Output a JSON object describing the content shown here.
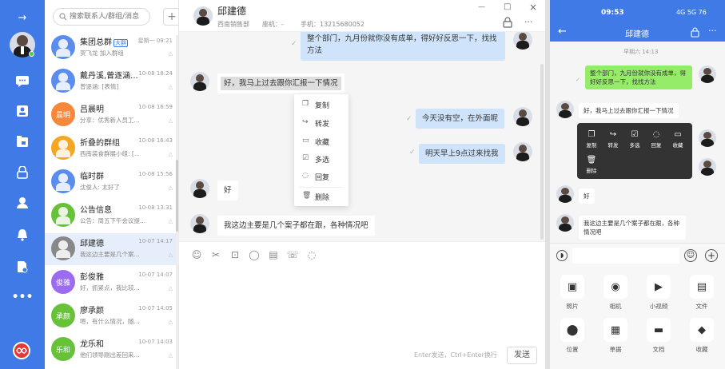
{
  "sidebar": {
    "expand_icon": "arrow-right",
    "icons": [
      "chat-bubble",
      "contacts-card",
      "calendar-folder",
      "lock",
      "user",
      "bell",
      "document-settings",
      "more-dots"
    ]
  },
  "conv_list": {
    "search_placeholder": "搜索联系人/群组/消息",
    "add_label": "+",
    "items": [
      {
        "name": "集团总群",
        "tag": "大群",
        "time": "星期一 09:21",
        "preview": "贺飞龙 加入群组",
        "avatar_text": "",
        "color": "#5b8def",
        "selected": false
      },
      {
        "name": "戴丹溪,曾逐涵...",
        "tag": "",
        "time": "10-08 18:24",
        "preview": "曾逐涵: [表情]",
        "avatar_text": "",
        "color": "#5b8def",
        "selected": false
      },
      {
        "name": "吕晨明",
        "tag": "",
        "time": "10-08 16:59",
        "preview": "分享：优秀新人员工...",
        "avatar_text": "晨明",
        "color": "#f5883b",
        "selected": false
      },
      {
        "name": "折叠的群组",
        "tag": "",
        "time": "10-08 16:43",
        "preview": "西南装食群展小组: [...",
        "avatar_text": "",
        "color": "#f5a623",
        "selected": false
      },
      {
        "name": "临时群",
        "tag": "",
        "time": "10-08 15:56",
        "preview": "沈俊人: 太好了",
        "avatar_text": "",
        "color": "#5b8def",
        "selected": false
      },
      {
        "name": "公告信息",
        "tag": "",
        "time": "10-08 13:31",
        "preview": "公告：周五下午会议提...",
        "avatar_text": "",
        "color": "#67c23a",
        "selected": false
      },
      {
        "name": "邱建德",
        "tag": "",
        "time": "10-07 14:17",
        "preview": "我这边主要是几个案...",
        "avatar_text": "",
        "color": "#888888",
        "selected": true
      },
      {
        "name": "彭俊雅",
        "tag": "",
        "time": "10-07 14:07",
        "preview": "好，抓紧点，我比较...",
        "avatar_text": "俊雅",
        "color": "#9b6cf0",
        "selected": false
      },
      {
        "name": "廖承颜",
        "tag": "",
        "time": "10-07 14:05",
        "preview": "嗯，有什么情况，随...",
        "avatar_text": "承颜",
        "color": "#67c23a",
        "selected": false
      },
      {
        "name": "龙乐和",
        "tag": "",
        "time": "10-07 14:03",
        "preview": "他们领导刚出差回来...",
        "avatar_text": "乐和",
        "color": "#67c23a",
        "selected": false
      }
    ]
  },
  "chat": {
    "contact_name": "邱建德",
    "department": "西南销售部",
    "landline_label": "座机：-",
    "mobile_label": "手机：13215680052",
    "window_controls": [
      "—",
      "□",
      "×"
    ],
    "messages": {
      "m1": "整个部门，九月份就你没有成单，得好好反思一下，找找方法",
      "m2": "好，我马上过去跟你汇报一下情况",
      "m3": "今天没有空，在外面呢",
      "m4": "明天早上9点过来找我",
      "m5": "好",
      "m6": "我这边主要是几个案子都在跟，各种情况吧"
    },
    "context_menu": [
      "复制",
      "转发",
      "收藏",
      "多选",
      "回复",
      "删除"
    ],
    "toolbar_icons": [
      "emoji",
      "scissors",
      "folder",
      "chat",
      "document",
      "phone-call",
      "comment"
    ],
    "send_hint": "Enter发送，Ctrl+Enter换行",
    "send_label": "发送"
  },
  "phone": {
    "time": "09:53",
    "status_right": "4G 5G 76",
    "title": "邱建德",
    "date_label": "早期六 14:13",
    "messages": {
      "m1": "整个部门，九月份就你没有成单，得好好反思一下，找找方法",
      "m2": "好，我马上过去跟你汇报一下情况",
      "m3": "好",
      "m4": "我这边主要是几个案子都在跟，各种情况吧"
    },
    "popup": [
      "复制",
      "转发",
      "多选",
      "回复",
      "收藏",
      "删除"
    ],
    "grid": [
      "照片",
      "相机",
      "小视频",
      "文件",
      "位置",
      "单据",
      "文档",
      "收藏"
    ]
  }
}
